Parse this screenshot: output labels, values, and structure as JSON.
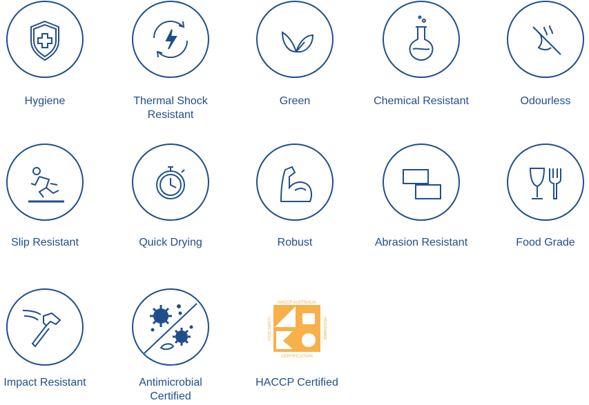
{
  "colors": {
    "primary": "#1f4e8c",
    "haccp": "#f7b04a"
  },
  "features": [
    {
      "label": "Hygiene",
      "icon": "shield-cross-icon"
    },
    {
      "label": "Thermal Shock\nResistant",
      "icon": "thermal-cycle-icon"
    },
    {
      "label": "Green",
      "icon": "leaf-icon"
    },
    {
      "label": "Chemical Resistant",
      "icon": "flask-icon"
    },
    {
      "label": "Odourless",
      "icon": "no-smell-icon"
    },
    {
      "label": "Slip Resistant",
      "icon": "slip-person-icon"
    },
    {
      "label": "Quick Drying",
      "icon": "stopwatch-icon"
    },
    {
      "label": "Robust",
      "icon": "flexed-arm-icon"
    },
    {
      "label": "Abrasion Resistant",
      "icon": "rectangles-icon"
    },
    {
      "label": "Food Grade",
      "icon": "glass-fork-icon"
    },
    {
      "label": "Impact Resistant",
      "icon": "hammer-icon"
    },
    {
      "label": "Antimicrobial\nCertified",
      "icon": "no-microbes-icon"
    },
    {
      "label": "HACCP Certified",
      "icon": "haccp-logo"
    }
  ],
  "haccp_logo": {
    "top": "HACCP AUSTRALIA",
    "left": "FOOD SAFETY",
    "right": "PROGRAMME",
    "bottom": "CERTIFICATION"
  }
}
